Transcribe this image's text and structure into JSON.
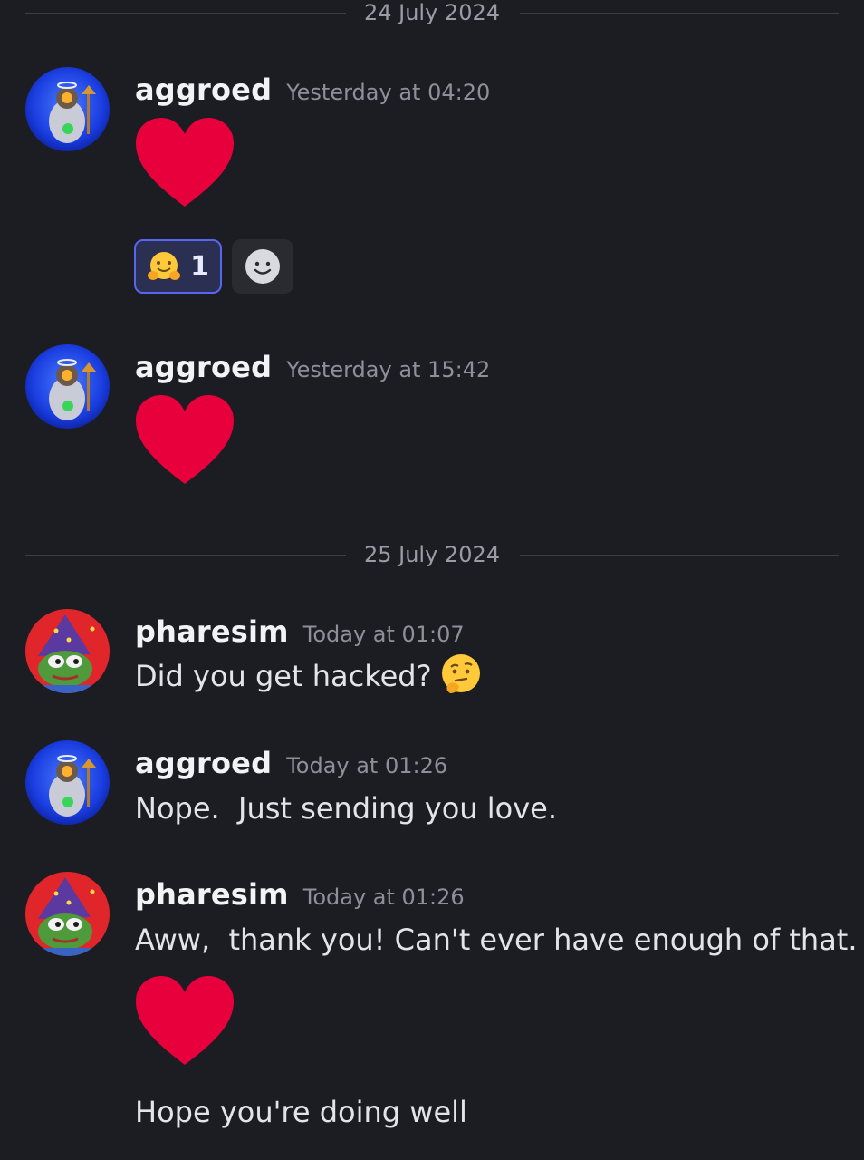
{
  "date_dividers": [
    "24 July 2024",
    "25 July 2024"
  ],
  "messages": [
    {
      "username": "aggroed",
      "timestamp": "Yesterday at 04:20",
      "content": "heart-emoji"
    },
    {
      "username": "aggroed",
      "timestamp": "Yesterday at 15:42",
      "content": "heart-emoji"
    },
    {
      "username": "pharesim",
      "timestamp": "Today at 01:07",
      "text": "Did you get hacked?"
    },
    {
      "username": "aggroed",
      "timestamp": "Today at 01:26",
      "text": "Nope.  Just sending you love."
    },
    {
      "username": "pharesim",
      "timestamp": "Today at 01:26",
      "text": "Aww,  thank you! Can't ever have enough of that.",
      "followups": [
        "Hope you're doing well"
      ]
    }
  ],
  "reactions": {
    "emoji": "hugging-face-icon",
    "count": "1"
  },
  "icons": {
    "heart": "heart-emoji-icon",
    "thinking": "thinking-face-icon",
    "add_reaction": "smiley-add-reaction-icon"
  },
  "colors": {
    "background": "#1c1d23",
    "heart": "#e8003d",
    "reaction_border": "#5865f2",
    "reaction_bg": "#2b2f52"
  }
}
